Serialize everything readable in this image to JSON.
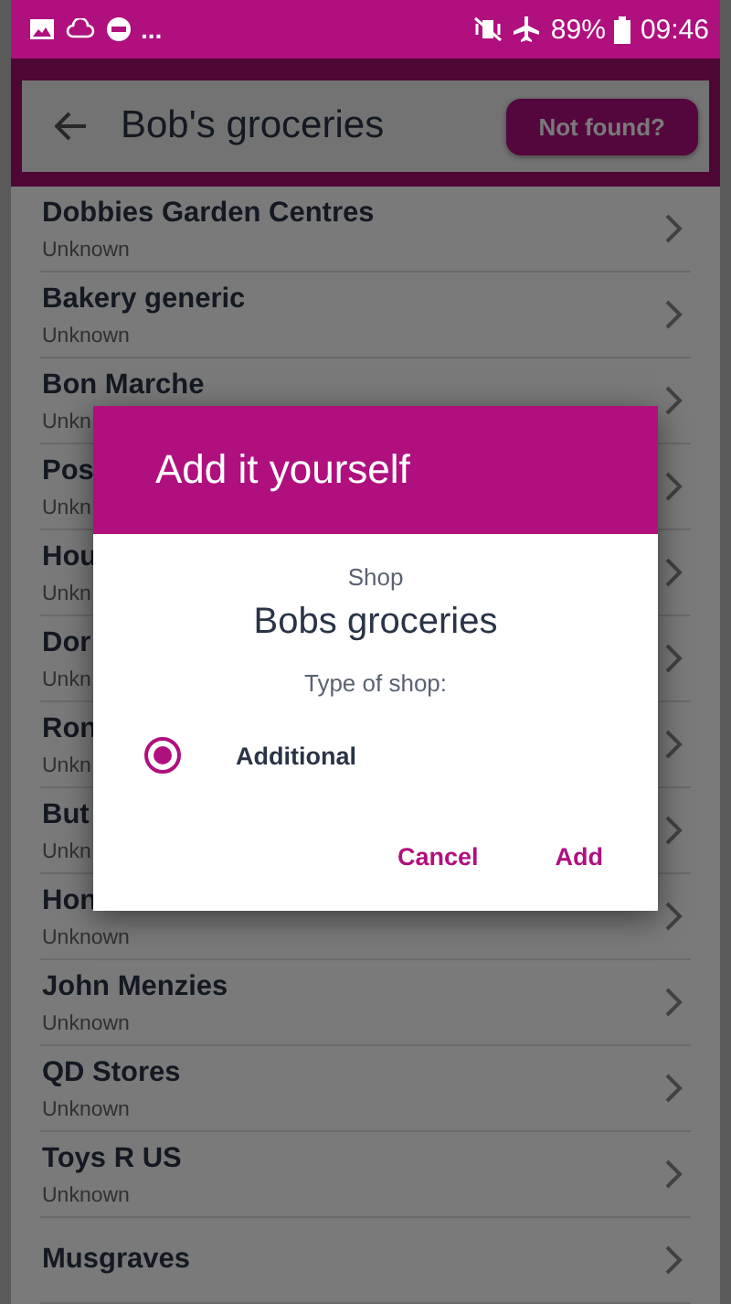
{
  "status_bar": {
    "more": "...",
    "battery": "89%",
    "time": "09:46"
  },
  "header": {
    "title": "Bob's groceries",
    "button": "Not found?"
  },
  "shops": [
    {
      "name": "Dobbies Garden Centres",
      "type": "Unknown"
    },
    {
      "name": "Bakery generic",
      "type": "Unknown"
    },
    {
      "name": "Bon Marche",
      "type": "Unkn"
    },
    {
      "name": "Pos",
      "type": "Unkn"
    },
    {
      "name": "Hou",
      "type": "Unkn"
    },
    {
      "name": "Dor",
      "type": "Unkn"
    },
    {
      "name": "Ron",
      "type": "Unkn"
    },
    {
      "name": "But",
      "type": "Unkn"
    },
    {
      "name": "Hon",
      "type": "Unknown"
    },
    {
      "name": "John Menzies",
      "type": "Unknown"
    },
    {
      "name": "QD Stores",
      "type": "Unknown"
    },
    {
      "name": "Toys R US",
      "type": "Unknown"
    },
    {
      "name": "Musgraves"
    }
  ],
  "dialog": {
    "title": "Add it yourself",
    "label": "Shop",
    "shop_name": "Bobs groceries",
    "type_label": "Type of shop:",
    "options": [
      {
        "label": "Additional",
        "selected": true
      }
    ],
    "buttons": [
      "Cancel",
      "Add"
    ]
  }
}
